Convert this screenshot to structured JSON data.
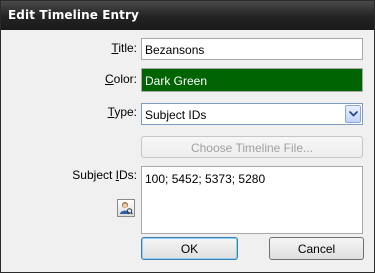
{
  "window": {
    "title": "Edit Timeline Entry"
  },
  "form": {
    "title_label_mnemonic": "T",
    "title_label_rest": "itle:",
    "title_value": "Bezansons",
    "color_label_mnemonic": "C",
    "color_label_rest": "olor:",
    "color_value": "Dark Green",
    "color_swatch": "#006400",
    "type_label_mnemonic": "T",
    "type_label_rest": "ype:",
    "type_value": "Subject IDs",
    "choose_file_label": "Choose Timeline File...",
    "subject_ids_label_prefix": "Subject ",
    "subject_ids_label_mnemonic": "I",
    "subject_ids_label_rest": "Ds:",
    "subject_ids_value": "100; 5452; 5373; 5280",
    "subject_picker_icon": "person-icon"
  },
  "buttons": {
    "ok_label": "OK",
    "cancel_label": "Cancel"
  },
  "colors": {
    "titlebar": "#232323",
    "dialog_background": "#f0f0f0",
    "color_field_background": "#006400"
  }
}
